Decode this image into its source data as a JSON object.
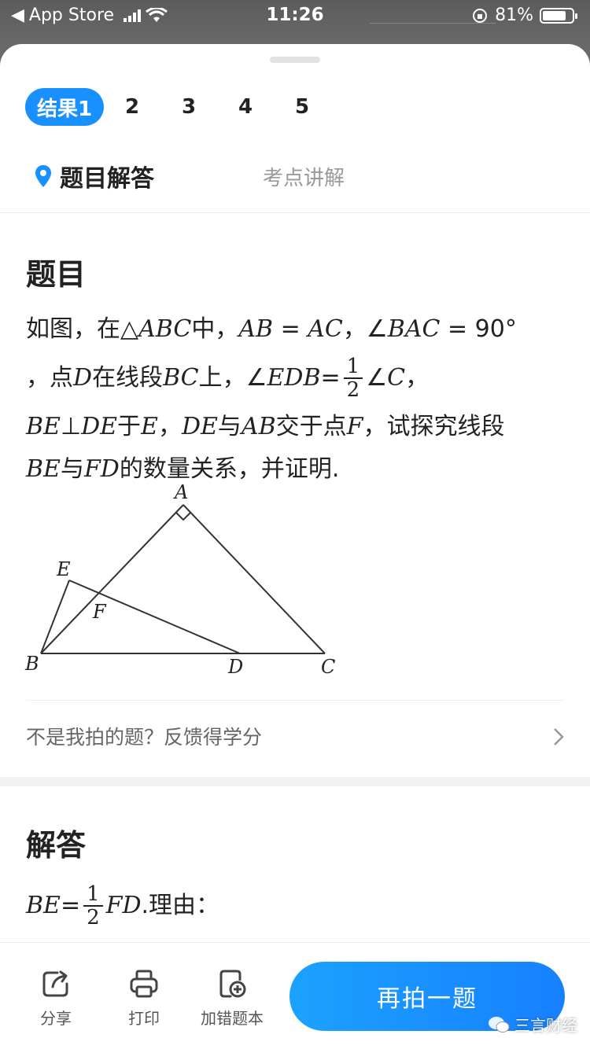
{
  "status_bar": {
    "back_app": "App Store",
    "time": "11:26",
    "battery_percent": "81%",
    "battery_level": 0.81
  },
  "result_tabs": [
    {
      "label": "结果1",
      "active": true
    },
    {
      "label": "2",
      "active": false
    },
    {
      "label": "3",
      "active": false
    },
    {
      "label": "4",
      "active": false
    },
    {
      "label": "5",
      "active": false
    }
  ],
  "section_tabs": {
    "answer_tab": "题目解答",
    "explain_tab": "考点讲解"
  },
  "question": {
    "heading": "题目",
    "line1_a": "如图，在△",
    "line1_abc": "ABC",
    "line1_b": "中，",
    "line1_ab": "AB",
    "line1_eq1": " = ",
    "line1_ac": "AC",
    "line1_c": "，∠",
    "line1_bac": "BAC",
    "line1_eq2": " = 90°",
    "line2_a": "，点",
    "line2_d": "D",
    "line2_b": "在线段",
    "line2_bc": "BC",
    "line2_c": "上，∠",
    "line2_edb": "EDB",
    "line2_eq": " = ",
    "frac_num": "1",
    "frac_den": "2",
    "line2_angle": "∠",
    "line2_cc": "C",
    "line2_end": "，",
    "line3_be": "BE",
    "line3_perp": "⊥",
    "line3_de": "DE",
    "line3_a": "于",
    "line3_e": "E",
    "line3_b": "，",
    "line3_de2": "DE",
    "line3_c": "与",
    "line3_ab": "AB",
    "line3_d": "交于点",
    "line3_f": "F",
    "line3_e2": "，试探究线段",
    "line4_be": "BE",
    "line4_a": "与",
    "line4_fd": "FD",
    "line4_b": "的数量关系，并证明."
  },
  "figure_labels": {
    "A": "A",
    "B": "B",
    "C": "C",
    "D": "D",
    "E": "E",
    "F": "F"
  },
  "feedback": "不是我拍的题？反馈得学分",
  "answer": {
    "heading": "解答",
    "be": "BE",
    "eq": " = ",
    "frac_num": "1",
    "frac_den": "2",
    "fd": "FD",
    "tail": ".理由："
  },
  "bottom_bar": {
    "share": "分享",
    "print": "打印",
    "add_mistake": "加错题本",
    "retake": "再拍一题"
  },
  "watermark": "三言财经",
  "colors": {
    "accent": "#1890ff",
    "muted": "#999999"
  }
}
